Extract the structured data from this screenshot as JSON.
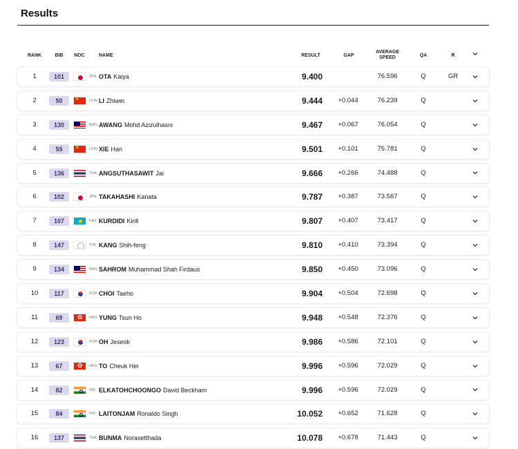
{
  "page": {
    "title": "Results"
  },
  "columns": {
    "rank": "RANK",
    "bib": "BIB",
    "noc": "NOC",
    "name": "NAME",
    "result": "RESULT",
    "gap": "GAP",
    "speed_line1": "AVERAGE",
    "speed_line2": "SPEED",
    "qa": "QA",
    "r": "R"
  },
  "rows": [
    {
      "rank": "1",
      "bib": "101",
      "noc": "JPN",
      "flag": "jpn",
      "last": "OTA",
      "first": "Kaiya",
      "result": "9.400",
      "gap": "",
      "speed": "76.596",
      "qa": "Q",
      "r": "GR"
    },
    {
      "rank": "2",
      "bib": "50",
      "noc": "CHN",
      "flag": "chn",
      "last": "LI",
      "first": "Zhiwei",
      "result": "9.444",
      "gap": "+0.044",
      "speed": "76.239",
      "qa": "Q",
      "r": ""
    },
    {
      "rank": "3",
      "bib": "130",
      "noc": "MAS",
      "flag": "mas",
      "last": "AWANG",
      "first": "Mohd Azizulhasni",
      "result": "9.467",
      "gap": "+0.067",
      "speed": "76.054",
      "qa": "Q",
      "r": ""
    },
    {
      "rank": "4",
      "bib": "55",
      "noc": "CHN",
      "flag": "chn",
      "last": "XIE",
      "first": "Han",
      "result": "9.501",
      "gap": "+0.101",
      "speed": "75.781",
      "qa": "Q",
      "r": ""
    },
    {
      "rank": "5",
      "bib": "136",
      "noc": "THA",
      "flag": "tha",
      "last": "ANGSUTHASAWIT",
      "first": "Jai",
      "result": "9.666",
      "gap": "+0.266",
      "speed": "74.488",
      "qa": "Q",
      "r": ""
    },
    {
      "rank": "6",
      "bib": "102",
      "noc": "JPN",
      "flag": "jpn",
      "last": "TAKAHASHI",
      "first": "Kanata",
      "result": "9.787",
      "gap": "+0.387",
      "speed": "73.567",
      "qa": "Q",
      "r": ""
    },
    {
      "rank": "7",
      "bib": "107",
      "noc": "KAZ",
      "flag": "kaz",
      "last": "KURDIDI",
      "first": "Kirill",
      "result": "9.807",
      "gap": "+0.407",
      "speed": "73.417",
      "qa": "Q",
      "r": ""
    },
    {
      "rank": "8",
      "bib": "147",
      "noc": "TPE",
      "flag": "tpe",
      "last": "KANG",
      "first": "Shih-feng",
      "result": "9.810",
      "gap": "+0.410",
      "speed": "73.394",
      "qa": "Q",
      "r": ""
    },
    {
      "rank": "9",
      "bib": "134",
      "noc": "MAS",
      "flag": "mas",
      "last": "SAHROM",
      "first": "Muhammad Shah Firdaus",
      "result": "9.850",
      "gap": "+0.450",
      "speed": "73.096",
      "qa": "Q",
      "r": ""
    },
    {
      "rank": "10",
      "bib": "117",
      "noc": "KOR",
      "flag": "kor",
      "last": "CHOI",
      "first": "Taeho",
      "result": "9.904",
      "gap": "+0.504",
      "speed": "72.698",
      "qa": "Q",
      "r": ""
    },
    {
      "rank": "11",
      "bib": "69",
      "noc": "HKG",
      "flag": "hkg",
      "last": "YUNG",
      "first": "Tsun Ho",
      "result": "9.948",
      "gap": "+0.548",
      "speed": "72.376",
      "qa": "Q",
      "r": ""
    },
    {
      "rank": "12",
      "bib": "123",
      "noc": "KOR",
      "flag": "kor",
      "last": "OH",
      "first": "Jeseok",
      "result": "9.986",
      "gap": "+0.586",
      "speed": "72.101",
      "qa": "Q",
      "r": ""
    },
    {
      "rank": "13",
      "bib": "67",
      "noc": "HKG",
      "flag": "hkg",
      "last": "TO",
      "first": "Cheuk Hei",
      "result": "9.996",
      "gap": "+0.596",
      "speed": "72.029",
      "qa": "Q",
      "r": ""
    },
    {
      "rank": "14",
      "bib": "82",
      "noc": "IND",
      "flag": "ind",
      "last": "ELKATOHCHOONGO",
      "first": "David Beckham",
      "result": "9.996",
      "gap": "+0.596",
      "speed": "72.029",
      "qa": "Q",
      "r": ""
    },
    {
      "rank": "15",
      "bib": "84",
      "noc": "IND",
      "flag": "ind",
      "last": "LAITONJAM",
      "first": "Ronaldo Singh",
      "result": "10.052",
      "gap": "+0.652",
      "speed": "71.628",
      "qa": "Q",
      "r": ""
    },
    {
      "rank": "16",
      "bib": "137",
      "noc": "THA",
      "flag": "tha",
      "last": "BUNMA",
      "first": "Norasetthada",
      "result": "10.078",
      "gap": "+0.678",
      "speed": "71.443",
      "qa": "Q",
      "r": ""
    }
  ]
}
